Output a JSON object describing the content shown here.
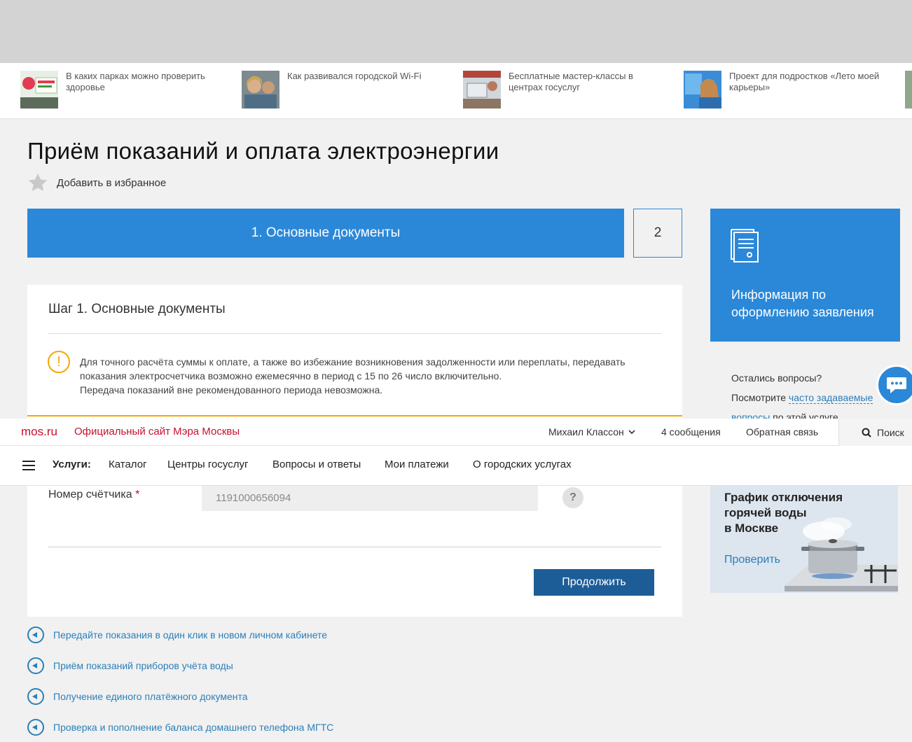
{
  "news": [
    {
      "text": "В каких парках можно проверить здоровье",
      "image": "zdorovaya-moskva-photo"
    },
    {
      "text": "Как развивался городской Wi-Fi",
      "image": "women-with-phone-photo"
    },
    {
      "text": "Бесплатные мастер-классы в центрах госуслуг",
      "image": "workshop-photo"
    },
    {
      "text": "Проект для подростков «Лето моей карьеры»",
      "image": "teen-girl-photo"
    }
  ],
  "page": {
    "title": "Приём показаний и оплата электроэнергии",
    "favorite_label": "Добавить в избранное"
  },
  "steps": {
    "active": "1. Основные документы",
    "next": "2"
  },
  "form": {
    "heading": "Шаг 1. Основные документы",
    "notice_line1": "Для точного расчёта суммы к оплате, а также во избежание возникновения задолженности или переплаты, передавать показания электросчетчика возможно ежемесячно в период с 15 по 26 число включительно.",
    "notice_line2": "Передача показаний вне рекомендованного периода невозможна.",
    "meter_label": "Номер счётчика",
    "required_mark": "*",
    "meter_value": "1191000656094",
    "help_glyph": "?",
    "continue_label": "Продолжить"
  },
  "related": [
    "Передайте показания в один клик в новом личном кабинете",
    "Приём показаний приборов учёта воды",
    "Получение единого платёжного документа",
    "Проверка и пополнение баланса домашнего телефона МГТС"
  ],
  "sidebar": {
    "info_title": "Информация по оформлению заявления",
    "faq_q": "Остались вопросы?",
    "faq_prefix": "Посмотрите ",
    "faq_link": "часто задаваемые вопросы",
    "faq_suffix": " по этой услуге",
    "water_title_1": "График отключения",
    "water_title_2": "горячей воды",
    "water_title_3": "в Москве",
    "water_link": "Проверить"
  },
  "header": {
    "logo": "mos.ru",
    "site_name": "Официальный сайт Мэра Москвы",
    "user": "Михаил Классон",
    "messages": "4 сообщения",
    "feedback": "Обратная связь",
    "search": "Поиск",
    "nav_label": "Услуги:",
    "nav": [
      "Каталог",
      "Центры госуслуг",
      "Вопросы и ответы",
      "Мои платежи",
      "О городских услугах"
    ]
  },
  "colors": {
    "primary_blue": "#2b88d8",
    "button_blue": "#1d5d97",
    "link_blue": "#2b7fb8",
    "warning": "#f2a900",
    "brand_red": "#c8102e"
  }
}
